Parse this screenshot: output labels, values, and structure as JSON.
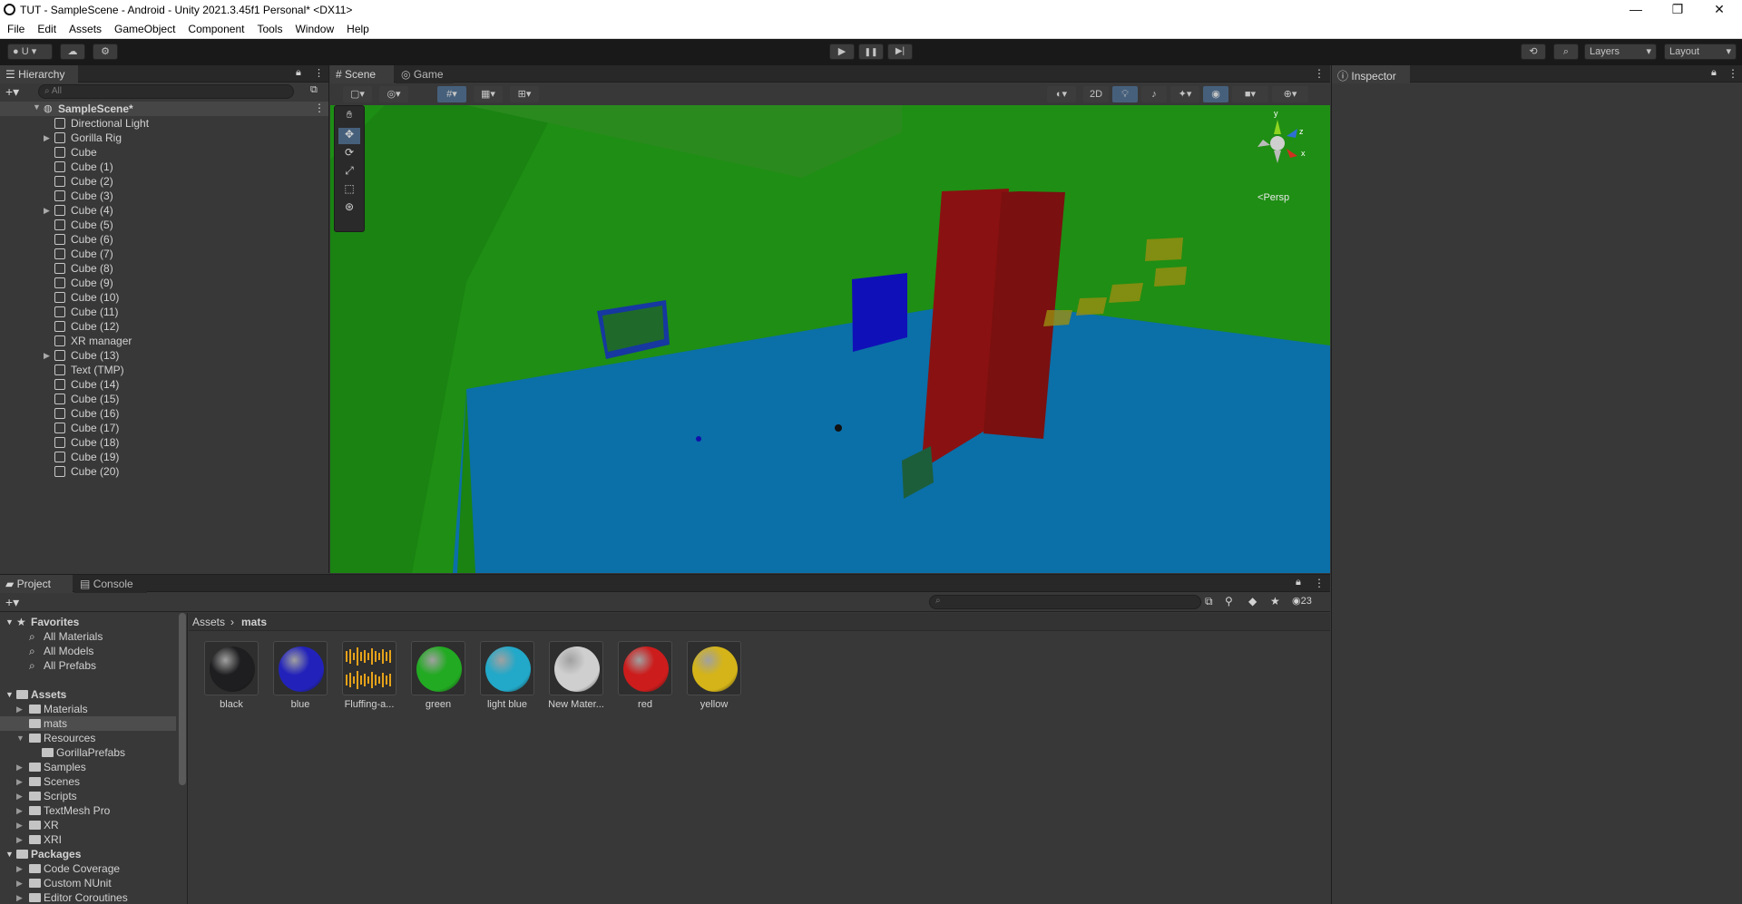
{
  "window": {
    "title": "TUT - SampleScene - Android - Unity 2021.3.45f1 Personal* <DX11>",
    "minimize": "—",
    "restore": "❐",
    "close": "✕"
  },
  "menu": [
    "File",
    "Edit",
    "Assets",
    "GameObject",
    "Component",
    "Tools",
    "Window",
    "Help"
  ],
  "toolbar": {
    "account": "U",
    "layers": "Layers",
    "layout": "Layout",
    "play": "▶",
    "pause": "❚❚",
    "step": "▶|"
  },
  "hierarchy": {
    "tab": "Hierarchy",
    "search_placeholder": "All",
    "scene": "SampleScene*",
    "items": [
      {
        "label": "Directional Light",
        "expandable": false
      },
      {
        "label": "Gorilla Rig",
        "expandable": true
      },
      {
        "label": "Cube",
        "expandable": false
      },
      {
        "label": "Cube (1)",
        "expandable": false
      },
      {
        "label": "Cube (2)",
        "expandable": false
      },
      {
        "label": "Cube (3)",
        "expandable": false
      },
      {
        "label": "Cube (4)",
        "expandable": true
      },
      {
        "label": "Cube (5)",
        "expandable": false
      },
      {
        "label": "Cube (6)",
        "expandable": false
      },
      {
        "label": "Cube (7)",
        "expandable": false
      },
      {
        "label": "Cube (8)",
        "expandable": false
      },
      {
        "label": "Cube (9)",
        "expandable": false
      },
      {
        "label": "Cube (10)",
        "expandable": false
      },
      {
        "label": "Cube (11)",
        "expandable": false
      },
      {
        "label": "Cube (12)",
        "expandable": false
      },
      {
        "label": "XR manager",
        "expandable": false
      },
      {
        "label": "Cube (13)",
        "expandable": true
      },
      {
        "label": "Text (TMP)",
        "expandable": false
      },
      {
        "label": "Cube (14)",
        "expandable": false
      },
      {
        "label": "Cube (15)",
        "expandable": false
      },
      {
        "label": "Cube (16)",
        "expandable": false
      },
      {
        "label": "Cube (17)",
        "expandable": false
      },
      {
        "label": "Cube (18)",
        "expandable": false
      },
      {
        "label": "Cube (19)",
        "expandable": false
      },
      {
        "label": "Cube (20)",
        "expandable": false
      }
    ]
  },
  "scene_view": {
    "tabs": [
      "Scene",
      "Game"
    ],
    "mode_2d": "2D",
    "persp": "Persp",
    "gizmo_y": "y",
    "gizmo_z": "z",
    "gizmo_x": "x"
  },
  "inspector": {
    "tab": "Inspector"
  },
  "project": {
    "tabs": [
      "Project",
      "Console"
    ],
    "breadcrumb": [
      "Assets",
      "mats"
    ],
    "count": "23",
    "favorites": {
      "label": "Favorites",
      "items": [
        "All Materials",
        "All Models",
        "All Prefabs"
      ]
    },
    "assets_root": "Assets",
    "tree": [
      {
        "label": "Materials",
        "depth": 1,
        "expandable": true
      },
      {
        "label": "mats",
        "depth": 1,
        "expandable": false,
        "selected": true
      },
      {
        "label": "Resources",
        "depth": 1,
        "expandable": true,
        "expanded": true
      },
      {
        "label": "GorillaPrefabs",
        "depth": 2,
        "expandable": false
      },
      {
        "label": "Samples",
        "depth": 1,
        "expandable": true
      },
      {
        "label": "Scenes",
        "depth": 1,
        "expandable": true
      },
      {
        "label": "Scripts",
        "depth": 1,
        "expandable": true
      },
      {
        "label": "TextMesh Pro",
        "depth": 1,
        "expandable": true
      },
      {
        "label": "XR",
        "depth": 1,
        "expandable": true
      },
      {
        "label": "XRI",
        "depth": 1,
        "expandable": true
      }
    ],
    "packages_root": "Packages",
    "packages": [
      "Code Coverage",
      "Custom NUnit",
      "Editor Coroutines"
    ],
    "assets": [
      {
        "name": "black",
        "color": "#1e1e20"
      },
      {
        "name": "blue",
        "color": "#2222bb"
      },
      {
        "name": "Fluffing-a...",
        "color": "audio"
      },
      {
        "name": "green",
        "color": "#22aa22"
      },
      {
        "name": "light blue",
        "color": "#22a8c8"
      },
      {
        "name": "New Mater...",
        "color": "#cfcfcf"
      },
      {
        "name": "red",
        "color": "#cc1c1c"
      },
      {
        "name": "yellow",
        "color": "#d4b418"
      }
    ]
  }
}
